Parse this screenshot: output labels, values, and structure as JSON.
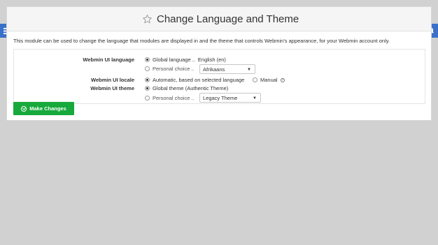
{
  "header": {
    "title": "Change Language and Theme"
  },
  "description": "This module can be used to change the language that modules are displayed in and the theme that controls Webmin's appearance, for your Webmin account only.",
  "form": {
    "ui_language": {
      "label": "Webmin UI language",
      "option_global": "Global language ..",
      "global_value": "English (en)",
      "option_personal": "Personal choice ..",
      "personal_select_value": "Afrikaans",
      "selected": "global"
    },
    "ui_locale": {
      "label": "Webmin UI locale",
      "option_auto": "Automatic, based on selected language",
      "option_manual": "Manual",
      "selected": "auto"
    },
    "ui_theme": {
      "label": "Webmin UI theme",
      "option_global": "Global theme (Authentic Theme)",
      "option_personal": "Personal choice ..",
      "personal_select_value": "Legacy Theme",
      "selected": "global"
    }
  },
  "actions": {
    "submit_label": "Make Changes"
  },
  "colors": {
    "accent_blue": "#3a70c9",
    "submit_green": "#17a93c"
  },
  "icons": {
    "menu": "hamburger-icon",
    "notifications": "bell-icon",
    "favorite": "star-icon",
    "submit": "check-circle-icon"
  }
}
